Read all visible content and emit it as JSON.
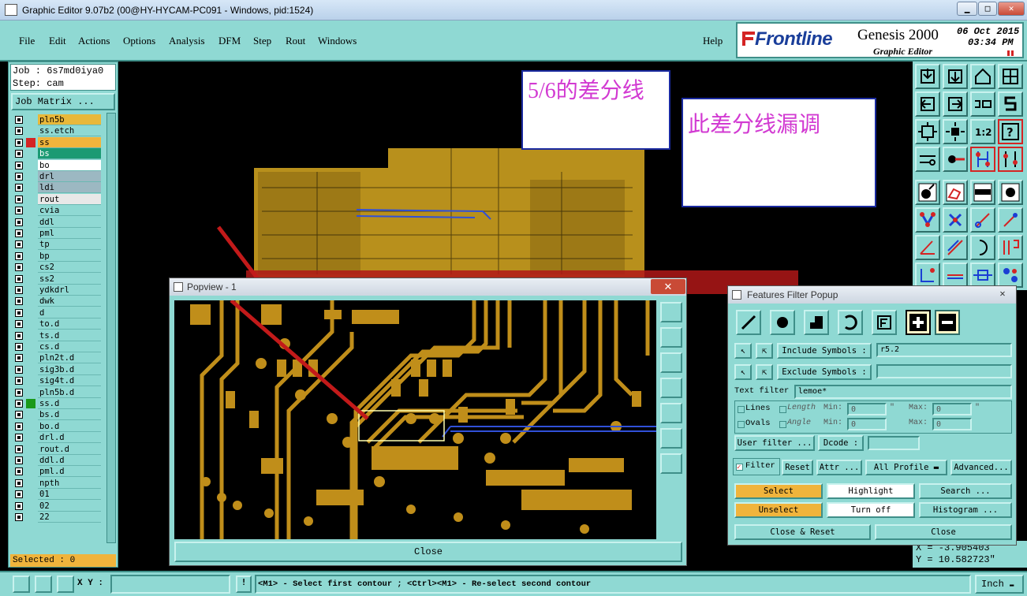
{
  "window": {
    "title": "Graphic Editor 9.07b2 (00@HY-HYCAM-PC091 - Windows, pid:1524)"
  },
  "menu": {
    "items": [
      "File",
      "Edit",
      "Actions",
      "Options",
      "Analysis",
      "DFM",
      "Step",
      "Rout",
      "Windows"
    ],
    "help": "Help"
  },
  "brand": {
    "logo": "Frontline",
    "product": "Genesis 2000",
    "subtitle": "Graphic Editor",
    "date": "06 Oct 2015",
    "time": "03:34 PM"
  },
  "job": {
    "job": "Job : 6s7md0iya0",
    "step": "Step: cam",
    "matrix_button": "Job Matrix ..."
  },
  "layers": [
    {
      "name": "pln5b",
      "bg": "#e8b83a"
    },
    {
      "name": "ss.etch",
      "bg": "#8fd9d3"
    },
    {
      "name": "ss",
      "bg": "#f0b43c",
      "mark": "#d42424"
    },
    {
      "name": "bs",
      "bg": "#1b9a73"
    },
    {
      "name": "bo",
      "bg": "#ffffff"
    },
    {
      "name": "drl",
      "bg": "#9cb8c2"
    },
    {
      "name": "ldi",
      "bg": "#9cb8c2"
    },
    {
      "name": "rout",
      "bg": "#e8e8e8"
    },
    {
      "name": "cvia",
      "bg": "#8fd9d3"
    },
    {
      "name": "ddl",
      "bg": "#8fd9d3"
    },
    {
      "name": "pml",
      "bg": "#8fd9d3"
    },
    {
      "name": "tp",
      "bg": "#8fd9d3"
    },
    {
      "name": "bp",
      "bg": "#8fd9d3"
    },
    {
      "name": "cs2",
      "bg": "#8fd9d3"
    },
    {
      "name": "ss2",
      "bg": "#8fd9d3"
    },
    {
      "name": "ydkdrl",
      "bg": "#8fd9d3"
    },
    {
      "name": "dwk",
      "bg": "#8fd9d3"
    },
    {
      "name": "d",
      "bg": "#8fd9d3"
    },
    {
      "name": "to.d",
      "bg": "#8fd9d3"
    },
    {
      "name": "ts.d",
      "bg": "#8fd9d3"
    },
    {
      "name": "cs.d",
      "bg": "#8fd9d3"
    },
    {
      "name": "pln2t.d",
      "bg": "#8fd9d3"
    },
    {
      "name": "sig3b.d",
      "bg": "#8fd9d3"
    },
    {
      "name": "sig4t.d",
      "bg": "#8fd9d3"
    },
    {
      "name": "pln5b.d",
      "bg": "#8fd9d3"
    },
    {
      "name": "ss.d",
      "bg": "#8fd9d3",
      "mark": "#1a9a1a"
    },
    {
      "name": "bs.d",
      "bg": "#8fd9d3"
    },
    {
      "name": "bo.d",
      "bg": "#8fd9d3"
    },
    {
      "name": "drl.d",
      "bg": "#8fd9d3"
    },
    {
      "name": "rout.d",
      "bg": "#8fd9d3"
    },
    {
      "name": "ddl.d",
      "bg": "#8fd9d3"
    },
    {
      "name": "pml.d",
      "bg": "#8fd9d3"
    },
    {
      "name": "npth",
      "bg": "#8fd9d3"
    },
    {
      "name": "01",
      "bg": "#8fd9d3"
    },
    {
      "name": "02",
      "bg": "#8fd9d3"
    },
    {
      "name": "22",
      "bg": "#8fd9d3"
    }
  ],
  "selected": "Selected : 0",
  "notes": {
    "note1": "5/6的差分线",
    "note2": "此差分线漏调"
  },
  "popview": {
    "title": "Popview - 1",
    "close": "Close"
  },
  "filter": {
    "title": "Features Filter Popup",
    "include_label": "Include Symbols :",
    "include_value": "r5.2",
    "exclude_label": "Exclude Symbols :",
    "exclude_value": "",
    "text_filter_label": "Text filter",
    "text_filter_value": "lemoe*",
    "lines": "Lines",
    "ovals": "Ovals",
    "length": "Length",
    "angle": "Angle",
    "min": "Min:",
    "max": "Max:",
    "len_min": "0",
    "len_max": "0",
    "ang_min": "0",
    "ang_max": "0",
    "unit": "\"",
    "user_filter": "User filter ...",
    "dcode": "Dcode :",
    "filter_btn": "Filter",
    "reset": "Reset",
    "attr": "Attr ...",
    "profile": "All Profile",
    "advanced": "Advanced...",
    "select": "Select",
    "highlight": "Highlight",
    "search": "Search ...",
    "unselect": "Unselect",
    "turn_off": "Turn off",
    "histogram": "Histogram ...",
    "close_reset": "Close & Reset",
    "close": "Close"
  },
  "coords": {
    "x": "X = -3.905403",
    "y": "Y = 10.582723\""
  },
  "status": {
    "xy_label": "X Y :",
    "message": "<M1> - Select first contour ; <Ctrl><M1> - Re-select second contour",
    "units": "Inch"
  }
}
